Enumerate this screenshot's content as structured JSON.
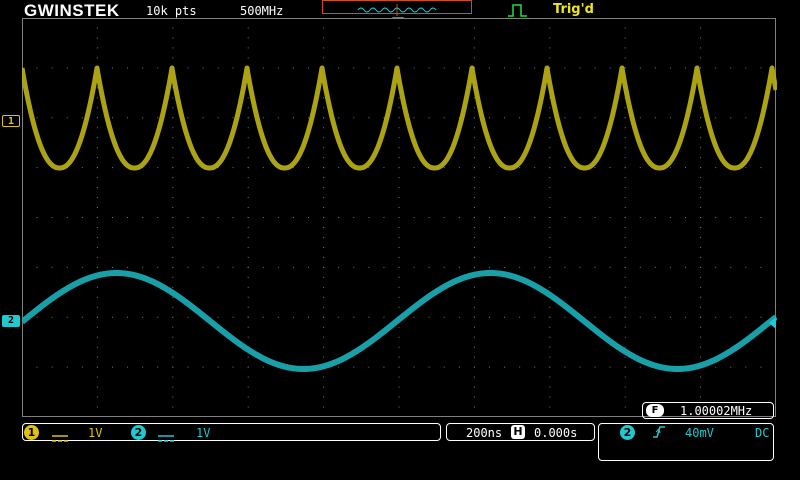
{
  "header": {
    "brand": "GWINSTEK",
    "record_length": "10k pts",
    "bandwidth": "500MHz",
    "trigger_status": "Trig'd"
  },
  "channels": {
    "ch1": {
      "marker": "1",
      "badge": "1",
      "coupling_icon": "dc-coupling-icon",
      "scale": "1V",
      "color": "#e0c010"
    },
    "ch2": {
      "marker": "2",
      "badge": "2",
      "coupling_icon": "dc-coupling-icon",
      "scale": "1V",
      "color": "#20c8d0"
    }
  },
  "frequency": {
    "badge": "F",
    "value": "1.00002MHz"
  },
  "timebase": {
    "scale": "200ns",
    "h_badge": "H",
    "position": "0.000s"
  },
  "trigger": {
    "source": "2",
    "slope_icon": "rising-edge-icon",
    "level": "40mV",
    "coupling": "DC"
  }
}
